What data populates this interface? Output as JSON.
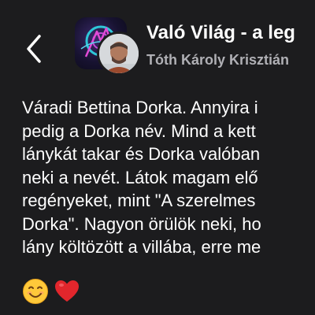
{
  "header": {
    "title": "Való Világ - a leg",
    "author": "Tóth Károly Krisztián"
  },
  "post": {
    "lines": [
      "Váradi Bettina Dorka. Annyira i",
      "pedig a Dorka név. Mind a kett",
      "lánykát takar és Dorka valóban",
      "neki a nevét. Látok magam elő",
      "regényeket, mint \"A szerelmes",
      "Dorka\". Nagyon örülök neki, ho",
      "lány költözött a villába, erre me"
    ],
    "emojis": [
      "smiling-face-emoji",
      "red-heart-emoji"
    ]
  },
  "colors": {
    "background": "#1c1c1e",
    "text": "#ffffff",
    "subtext": "#b0b0b5"
  }
}
